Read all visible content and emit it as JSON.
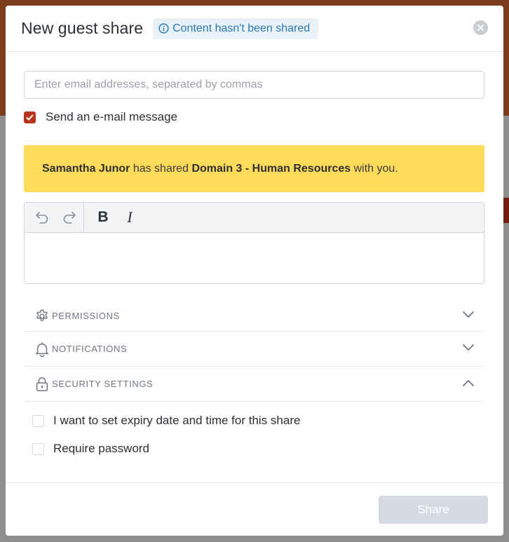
{
  "dialog": {
    "title": "New guest share",
    "status": "Content hasn't been shared"
  },
  "email": {
    "placeholder": "Enter email addresses, separated by commas",
    "value": ""
  },
  "send_email": {
    "label": "Send an e-mail message",
    "checked": true
  },
  "message": {
    "sender": "Samantha Junor",
    "action": "has shared",
    "item": "Domain 3 - Human Resources",
    "suffix": "with you."
  },
  "toolbar": {
    "bold": "B",
    "italic": "I"
  },
  "sections": [
    {
      "label": "PERMISSIONS",
      "icon": "gear-icon",
      "expanded": false
    },
    {
      "label": "NOTIFICATIONS",
      "icon": "bell-icon",
      "expanded": false
    },
    {
      "label": "SECURITY SETTINGS",
      "icon": "lock-icon",
      "expanded": true
    }
  ],
  "security_options": [
    {
      "label": "I want to set expiry date and time for this share",
      "checked": false
    },
    {
      "label": "Require password",
      "checked": false
    }
  ],
  "footer": {
    "share_label": "Share"
  },
  "colors": {
    "accent": "#b8331c",
    "banner": "#ffdb5c",
    "status_text": "#2b78b4",
    "status_bg": "#e9f2f9",
    "share_disabled": "#d5dae3"
  }
}
